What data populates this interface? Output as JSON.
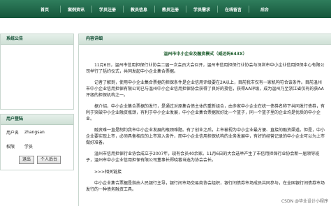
{
  "nav": {
    "items": [
      "首页",
      "案例资讯",
      "学员注册",
      "教员信息",
      "教员注册",
      "学员需求",
      "在线留言",
      "后台"
    ]
  },
  "sidebar": {
    "notice_title": "系统公告",
    "login_title": "用户登陆",
    "username_label": "用户名",
    "username_value": "zhangsan",
    "role_label": "权限",
    "role_value": "学员",
    "logout_button": "退出",
    "profile_button": "个人后台"
  },
  "main": {
    "header": "内容详细",
    "title": "温州市中小企业及融资模式（威达码643X）",
    "paragraphs": [
      "11月6日，温州市信用担保行业协会二届一次会员大会召开，温州市信用担保行业协会与深圳市中小企业信用担保中心有限公司举行了括约仪式，共同发起中小企业集合票据。",
      "记者了解到，使用中小企业集合票据的担保条件是企业信用评级要在2A以上，目前我市仅有一家机构符合该条件。目前温州市中小企业信用担保有限公司已与温州中小企业信用担保协会获得了良好的授信，获得AA评级，成为温州乃至浙江省仅有的获AA评级的担保机构之一。",
      "据介绍，中小企业集合票据的发行，是通过对原集合债主体的重新组合，由多家中小企业在统一债券名称下共同发行债券，有利于突破中小企业融资瓶颈，有利于中小企业发展，中小企业集合票据就好比一个篮子，同一个篮子里的企业均是优质的中小企业。",
      "融资难一直是制约我市中小企业发展的瓶颈难题。有了创业之后，上市被视为中小企业最方便、直接的融资渠道。但是，中小企业要实现上市，必须具备相应的上市准入条件，而中小企业信用担保机构的业务发展中，有好的经营记录的中小企业可以为上市做好准备。",
      "温州市信用担保行业协会成立于2007年，现有会员40余家。11月6日的大会选举产生了市信用担保行业协会新一届领导班子，温州市中小企业信用担保有限公司董事长郑晓蓉当选为协会会长。"
    ],
    "related_label": ">>>相关链接",
    "related_text": "中小企业集合票据是指由人民银行主导，银行间市场交易商协会组织，银行间债券市场成员共同参与，在全国银行间债券市场发行的一种债务融资工具。"
  },
  "watermark": "CSDN @毕业设计小程序"
}
